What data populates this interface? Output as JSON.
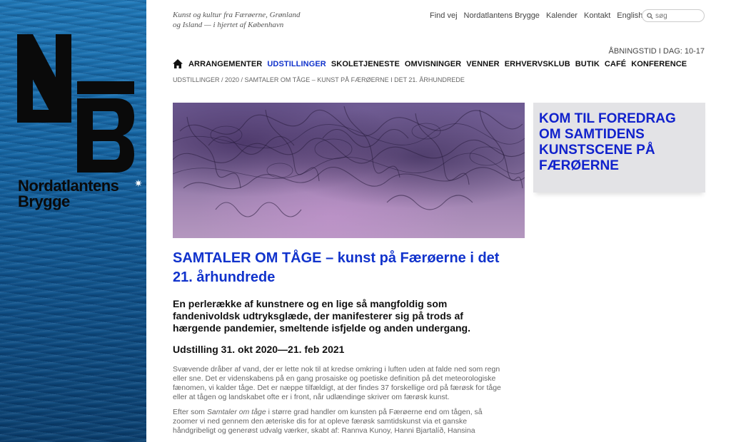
{
  "brand": {
    "name_line1": "Nordatlantens",
    "name_line2": "Brygge",
    "monogram": "N B"
  },
  "header": {
    "tagline_line1": "Kunst og kultur fra Færøerne, Grønland",
    "tagline_line2": "og Island — i hjertet af København",
    "top_links": [
      "Find vej",
      "Nordatlantens Brygge",
      "Kalender",
      "Kontakt",
      "English"
    ],
    "search_placeholder": "søg",
    "opening_hours": "ÅBNINGSTID I DAG: 10-17"
  },
  "main_nav": {
    "items": [
      "ARRANGEMENTER",
      "UDSTILLINGER",
      "SKOLETJENESTE",
      "OMVISNINGER",
      "VENNER",
      "ERHVERVSKLUB",
      "BUTIK",
      "CAFÉ",
      "KONFERENCE"
    ],
    "active": "UDSTILLINGER"
  },
  "breadcrumb": "UDSTILLINGER / 2020 / SAMTALER OM TÅGE – KUNST PÅ FÆRØERNE I DET 21. ÅRHUNDREDE",
  "promo": {
    "text": "KOM TIL FOREDRAG OM SAMTIDENS KUNSTSCENE PÅ FÆRØERNE"
  },
  "article": {
    "title": "SAMTALER OM TÅGE – kunst på Færøerne i det 21. århundrede",
    "lead": "En perlerække af kunstnere og en lige så mangfoldig som fandenivoldsk udtryksglæde, der manifesterer sig på trods af hærgende pandemier, smeltende isfjelde og anden undergang.",
    "dates": "Udstilling 31. okt 2020—21. feb 2021",
    "paragraph1": "Svævende dråber af vand, der er lette nok til at kredse omkring i luften uden at falde ned som regn eller sne. Det er videnskabens på en gang prosaiske og poetiske definition på det meteorologiske fænomen, vi kalder tåge. Det er næppe tilfældigt, at der findes 37 forskellige ord på færøsk for tåge eller at tågen og landskabet ofte er i front, når udlændinge skriver om færøsk kunst.",
    "paragraph2_prefix": "Efter som ",
    "paragraph2_italic": "Samtaler om tåge",
    "paragraph2_rest": " i større grad handler om kunsten på Færøerne end om tågen, så zoomer vi ned gennem den æteriske dis for at opleve færøsk samtidskunst via et ganske håndgribeligt og generøst udvalg værker, skabt af: Rannva Kunoy, Hanni Bjartalíð, Hansina"
  },
  "colors": {
    "accent_blue": "#1133cc",
    "promo_bg": "#e3e3e6"
  }
}
